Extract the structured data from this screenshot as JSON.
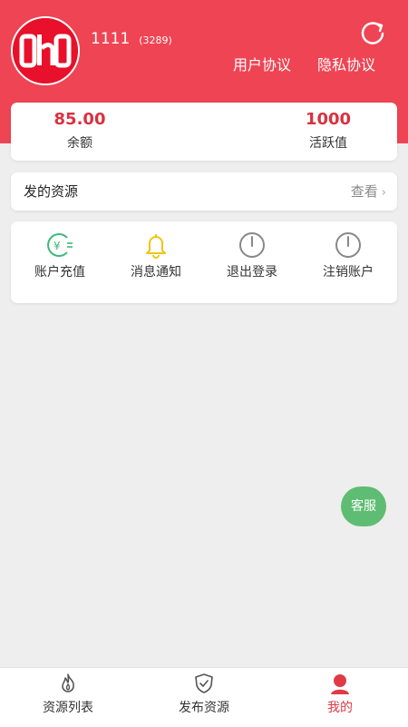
{
  "profile": {
    "avatar_logo_text": "OhO",
    "username": "1111",
    "user_id": "(3289)"
  },
  "header": {
    "refresh_icon": "refresh-icon",
    "user_agreement": "用户协议",
    "privacy_policy": "隐私协议"
  },
  "stats": {
    "balance_value": "85.00",
    "balance_label": "余额",
    "activity_value": "1000",
    "activity_label": "活跃值"
  },
  "resources": {
    "title": "发的资源",
    "view_label": "查看",
    "chevron": "›"
  },
  "actions": [
    {
      "label": "账户充值",
      "icon": "recharge-icon",
      "color": "#3cb97a"
    },
    {
      "label": "消息通知",
      "icon": "bell-icon",
      "color": "#f0c419"
    },
    {
      "label": "退出登录",
      "icon": "power-icon",
      "color": "#888888"
    },
    {
      "label": "注销账户",
      "icon": "power-icon",
      "color": "#888888"
    }
  ],
  "customer_service": {
    "label": "客服",
    "color": "#5fbd73"
  },
  "tabbar": [
    {
      "label": "资源列表",
      "icon": "flame-icon",
      "active": false
    },
    {
      "label": "发布资源",
      "icon": "shield-check-icon",
      "active": false
    },
    {
      "label": "我的",
      "icon": "user-icon",
      "active": true
    }
  ],
  "colors": {
    "brand_red": "#ef4453",
    "accent_value": "#d73340",
    "active_tab": "#e03a46"
  }
}
